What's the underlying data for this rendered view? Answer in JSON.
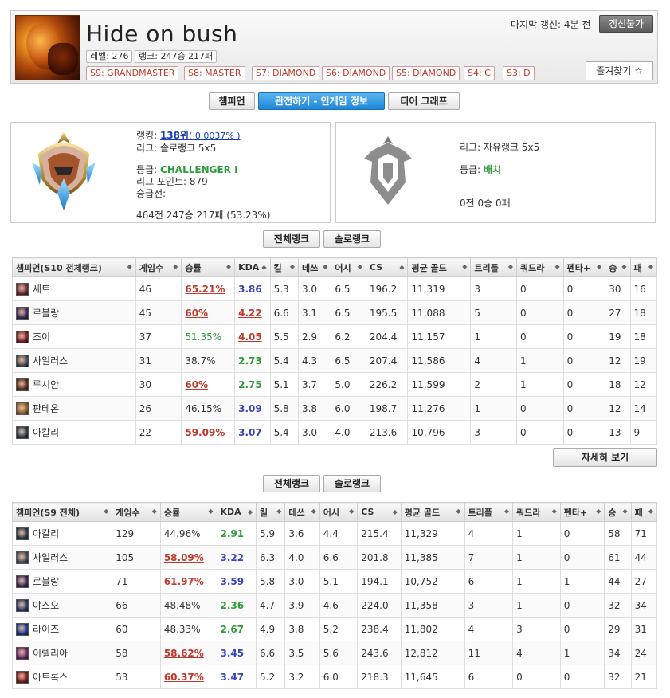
{
  "profile": {
    "name": "Hide on bush",
    "level_label": "레벨: 276",
    "rank_label": "랭크: 247승 217패",
    "seasons": [
      "S9: GRANDMASTER",
      "S8: MASTER",
      "S7: DIAMOND",
      "S6: DIAMOND",
      "S5: DIAMOND",
      "S4: C",
      "S3: D"
    ],
    "updated": "마지막 갱신: 4분 전",
    "refresh_label": "갱신불가",
    "favorite_label": "즐겨찾기 ☆"
  },
  "tabs": [
    "챔피언",
    "관전하기 - 인게임 정보",
    "티어 그래프"
  ],
  "solo": {
    "ranking_prefix": "랭킹: ",
    "ranking_link": "138위",
    "ranking_pct": "( 0.0037% )",
    "league": "리그: 솔로랭크 5x5",
    "tier_prefix": "등급: ",
    "tier": "CHALLENGER I",
    "points": "리그 포인트: 879",
    "promo": "승급전: -",
    "record": "464전 247승 217패 (53.23%)"
  },
  "flex": {
    "league": "리그: 자유랭크 5x5",
    "tier_prefix": "등급: ",
    "tier": "배치",
    "record": "0전 0승 0패"
  },
  "filter1": {
    "all": "전체랭크",
    "solo": "솔로랭크"
  },
  "filter2": {
    "all": "전체랭크",
    "solo": "솔로랭크"
  },
  "table1": {
    "headers": [
      "챔피언(S10 전체랭크)",
      "게임수",
      "승률",
      "KDA",
      "킬",
      "데쓰",
      "어시",
      "CS",
      "평균 골드",
      "트리플",
      "쿼드라",
      "펜타+",
      "승",
      "패"
    ],
    "rows": [
      {
        "champ": "세트",
        "games": "46",
        "wr": "65.21%",
        "kda": "3.86",
        "k": "5.3",
        "d": "3.0",
        "a": "6.5",
        "cs": "196.2",
        "gold": "11,319",
        "triple": "3",
        "quadra": "0",
        "penta": "0",
        "w": "30",
        "l": "16"
      },
      {
        "champ": "르블랑",
        "games": "45",
        "wr": "60%",
        "kda": "4.22",
        "k": "6.6",
        "d": "3.1",
        "a": "6.5",
        "cs": "195.5",
        "gold": "11,088",
        "triple": "5",
        "quadra": "0",
        "penta": "0",
        "w": "27",
        "l": "18"
      },
      {
        "champ": "조이",
        "games": "37",
        "wr": "51.35%",
        "kda": "4.05",
        "k": "5.5",
        "d": "2.9",
        "a": "6.2",
        "cs": "204.4",
        "gold": "11,157",
        "triple": "1",
        "quadra": "0",
        "penta": "0",
        "w": "19",
        "l": "18"
      },
      {
        "champ": "사일러스",
        "games": "31",
        "wr": "38.7%",
        "kda": "2.73",
        "k": "5.4",
        "d": "4.3",
        "a": "6.5",
        "cs": "207.4",
        "gold": "11,586",
        "triple": "4",
        "quadra": "1",
        "penta": "0",
        "w": "12",
        "l": "19"
      },
      {
        "champ": "루시안",
        "games": "30",
        "wr": "60%",
        "kda": "2.75",
        "k": "5.1",
        "d": "3.7",
        "a": "5.0",
        "cs": "226.2",
        "gold": "11,599",
        "triple": "2",
        "quadra": "1",
        "penta": "0",
        "w": "18",
        "l": "12"
      },
      {
        "champ": "판테온",
        "games": "26",
        "wr": "46.15%",
        "kda": "3.09",
        "k": "5.8",
        "d": "3.8",
        "a": "6.0",
        "cs": "198.7",
        "gold": "11,276",
        "triple": "1",
        "quadra": "0",
        "penta": "0",
        "w": "12",
        "l": "14"
      },
      {
        "champ": "아칼리",
        "games": "22",
        "wr": "59.09%",
        "kda": "3.07",
        "k": "5.4",
        "d": "3.0",
        "a": "4.0",
        "cs": "213.6",
        "gold": "10,796",
        "triple": "3",
        "quadra": "0",
        "penta": "0",
        "w": "13",
        "l": "9"
      }
    ]
  },
  "details_label": "자세히 보기",
  "table2": {
    "headers": [
      "챔피언(S9 전체)",
      "게임수",
      "승률",
      "KDA",
      "킬",
      "데쓰",
      "어시",
      "CS",
      "평균 골드",
      "트리플",
      "쿼드라",
      "펜타+",
      "승",
      "패"
    ],
    "rows": [
      {
        "champ": "아칼리",
        "games": "129",
        "wr": "44.96%",
        "kda": "2.91",
        "k": "5.9",
        "d": "3.6",
        "a": "4.4",
        "cs": "215.4",
        "gold": "11,329",
        "triple": "4",
        "quadra": "1",
        "penta": "0",
        "w": "58",
        "l": "71"
      },
      {
        "champ": "사일러스",
        "games": "105",
        "wr": "58.09%",
        "kda": "3.22",
        "k": "6.3",
        "d": "4.0",
        "a": "6.6",
        "cs": "201.8",
        "gold": "11,385",
        "triple": "7",
        "quadra": "1",
        "penta": "0",
        "w": "61",
        "l": "44"
      },
      {
        "champ": "르블랑",
        "games": "71",
        "wr": "61.97%",
        "kda": "3.59",
        "k": "5.8",
        "d": "3.0",
        "a": "5.1",
        "cs": "194.1",
        "gold": "10,752",
        "triple": "6",
        "quadra": "1",
        "penta": "1",
        "w": "44",
        "l": "27"
      },
      {
        "champ": "야스오",
        "games": "66",
        "wr": "48.48%",
        "kda": "2.36",
        "k": "4.7",
        "d": "3.9",
        "a": "4.6",
        "cs": "224.0",
        "gold": "11,358",
        "triple": "3",
        "quadra": "1",
        "penta": "0",
        "w": "32",
        "l": "34"
      },
      {
        "champ": "라이즈",
        "games": "60",
        "wr": "48.33%",
        "kda": "2.67",
        "k": "4.9",
        "d": "3.8",
        "a": "5.2",
        "cs": "238.4",
        "gold": "11,802",
        "triple": "4",
        "quadra": "3",
        "penta": "0",
        "w": "29",
        "l": "31"
      },
      {
        "champ": "이렐리아",
        "games": "58",
        "wr": "58.62%",
        "kda": "3.45",
        "k": "6.6",
        "d": "3.5",
        "a": "5.6",
        "cs": "243.6",
        "gold": "12,812",
        "triple": "11",
        "quadra": "4",
        "penta": "1",
        "w": "34",
        "l": "24"
      },
      {
        "champ": "아트록스",
        "games": "53",
        "wr": "60.37%",
        "kda": "3.47",
        "k": "5.2",
        "d": "3.2",
        "a": "6.0",
        "cs": "218.3",
        "gold": "11,645",
        "triple": "6",
        "quadra": "0",
        "penta": "0",
        "w": "32",
        "l": "21"
      }
    ]
  },
  "colors": {
    "accent_red": "#c0392b",
    "accent_green": "#2e9c3a",
    "accent_blue": "#3a46b8",
    "tab_active": "#1d86d8"
  }
}
